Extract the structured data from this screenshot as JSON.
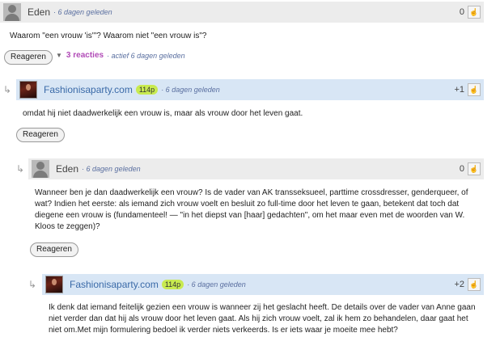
{
  "c1": {
    "user": "Eden",
    "meta": "· 6 dagen geleden",
    "score": "0",
    "text": "Waarom \"een vrouw 'is'\"? Waarom niet \"een vrouw is\"?",
    "reply": "Reageren",
    "reactions": "3 reacties",
    "active": "· actief 6 dagen geleden"
  },
  "c2": {
    "user": "Fashionisaparty.com",
    "badge": "114p",
    "meta": "· 6 dagen geleden",
    "score": "+1",
    "text": "omdat hij niet daadwerkelijk een vrouw is, maar als vrouw door het leven gaat.",
    "reply": "Reageren"
  },
  "c3": {
    "user": "Eden",
    "meta": "· 6 dagen geleden",
    "score": "0",
    "text": "Wanneer ben je dan daadwerkelijk een vrouw? Is de vader van AK transseksueel, parttime crossdresser, genderqueer, of wat? Indien het eerste: als iemand zich vrouw voelt en besluit zo full-time door het leven te gaan, betekent dat toch dat diegene een vrouw is (fundamenteel! — \"in het diepst van [haar] gedachten\", om het maar even met de woorden van W. Kloos te zeggen)?",
    "reply": "Reageren"
  },
  "c4": {
    "user": "Fashionisaparty.com",
    "badge": "114p",
    "meta": "· 6 dagen geleden",
    "score": "+2",
    "text": "Ik denk dat iemand feitelijk gezien een vrouw is wanneer zij het geslacht heeft. De details over de vader van Anne gaan niet verder dan dat hij als vrouw door het leven gaat. Als hij zich vrouw voelt, zal ik hem zo behandelen, daar gaat het niet om.Met mijn formulering bedoel ik verder niets verkeerds. Is er iets waar je moeite mee hebt?"
  },
  "icons": {
    "reply_arrow": "↳",
    "like": "👍",
    "dropdown": "▼"
  }
}
